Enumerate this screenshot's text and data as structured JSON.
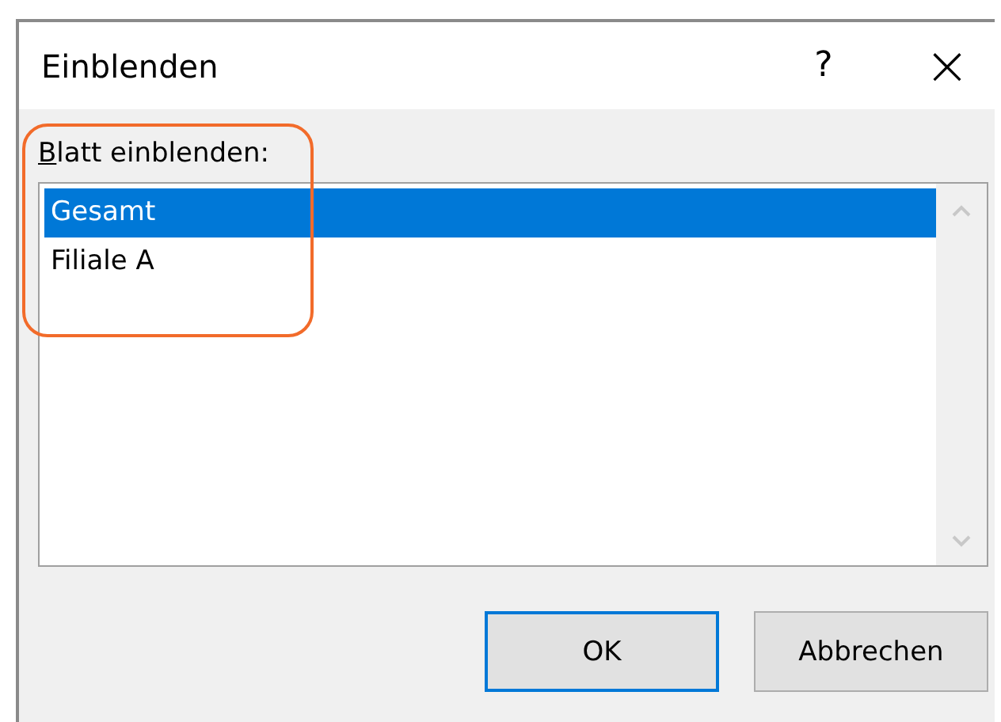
{
  "window": {
    "title": "Einblenden",
    "help": "?",
    "close": "×"
  },
  "label": {
    "text": "Blatt einblenden:",
    "access_key_underlined": true
  },
  "list": {
    "items": [
      {
        "label": "Gesamt",
        "selected": true
      },
      {
        "label": "Filiale A",
        "selected": false
      }
    ]
  },
  "buttons": [
    {
      "label": "OK",
      "default": true
    },
    {
      "label": "Abbrechen",
      "default": false
    }
  ]
}
